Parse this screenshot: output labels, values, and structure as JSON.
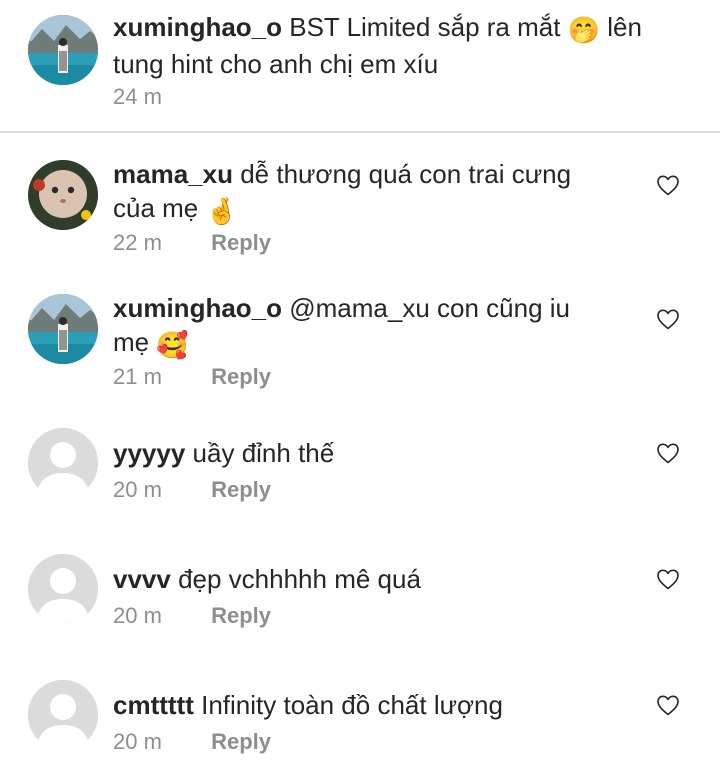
{
  "caption": {
    "username": "xuminghao_o",
    "text_line1": "BST Limited sắp ra mắt",
    "emoji1": "🤭",
    "text_after_emoji": "lên",
    "text_line2": "tung hint cho anh chị em xíu",
    "time": "24 m"
  },
  "comments": [
    {
      "username": "mama_xu",
      "text": "dễ thương quá con trai cưng",
      "text2": "của mẹ",
      "emoji": "🤞",
      "time": "22 m",
      "reply": "Reply"
    },
    {
      "username": "xuminghao_o",
      "text": "@mama_xu con cũng iu",
      "text2": "mẹ",
      "emoji": "🥰",
      "time": "21 m",
      "reply": "Reply"
    },
    {
      "username": "yyyyy",
      "text": "uầy đỉnh thế",
      "time": "20 m",
      "reply": "Reply"
    },
    {
      "username": "vvvv",
      "text": "đẹp vchhhhh mê quá",
      "time": "20 m",
      "reply": "Reply"
    },
    {
      "username": "cmttttt",
      "text": "Infinity toàn đồ chất lượng",
      "time": "20 m",
      "reply": "Reply"
    }
  ],
  "icons": {
    "like": "heart-outline-icon",
    "default_avatar": "default-avatar-icon"
  },
  "colors": {
    "text": "#262626",
    "secondary": "#8e8e8e",
    "divider": "#dbdbdb",
    "avatar_placeholder": "#dbdbdb"
  }
}
